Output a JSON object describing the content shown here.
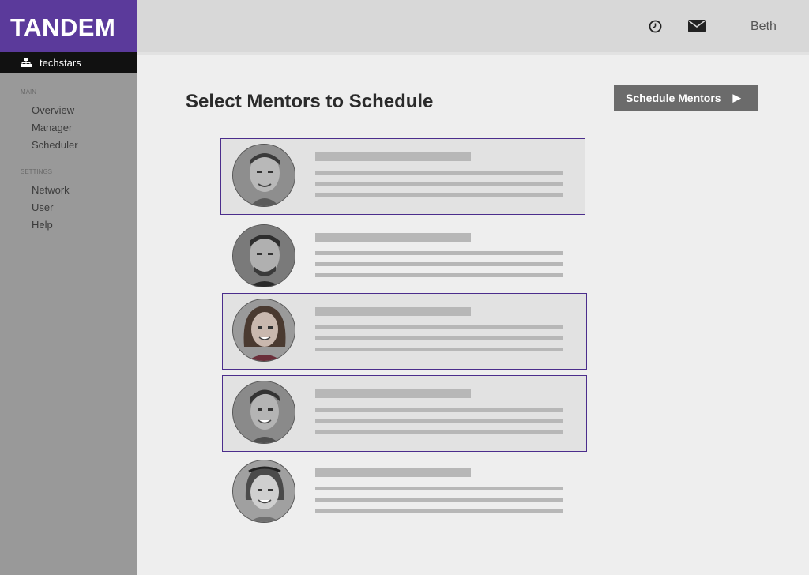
{
  "app": {
    "title": "TANDEM"
  },
  "org": {
    "name": "techstars"
  },
  "sidebar": {
    "sections": [
      {
        "title": "MAIN",
        "items": [
          "Overview",
          "Manager",
          "Scheduler"
        ]
      },
      {
        "title": "SETTINGS",
        "items": [
          "Network",
          "User",
          "Help"
        ]
      }
    ]
  },
  "header": {
    "user_name": "Beth"
  },
  "main": {
    "title": "Select Mentors to Schedule",
    "schedule_button_label": "Schedule Mentors",
    "schedule_button_arrow": "▶"
  },
  "mentors": [
    {
      "selected": true
    },
    {
      "selected": false
    },
    {
      "selected": true
    },
    {
      "selected": true
    },
    {
      "selected": false
    }
  ],
  "colors": {
    "brand": "#5b3a9b",
    "selected_border": "#4b2d8c",
    "sidebar": "#999999",
    "topbar": "#d8d8d8",
    "button": "#6b6b6b"
  },
  "icons": [
    "org-chart-icon",
    "clock-icon",
    "mail-icon",
    "play-icon"
  ]
}
